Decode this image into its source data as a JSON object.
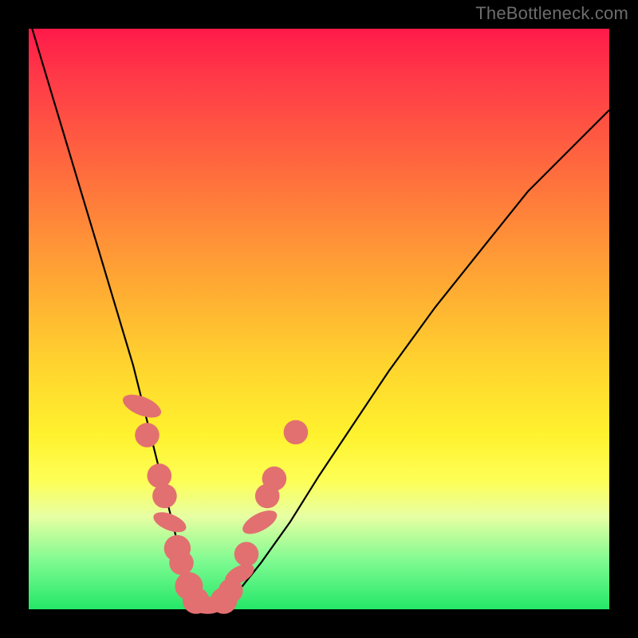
{
  "watermark": "TheBottleneck.com",
  "colors": {
    "page_bg": "#000000",
    "gradient_top": "#ff1a49",
    "gradient_bottom": "#24e768",
    "curve": "#000000",
    "marker": "#e27070"
  },
  "chart_data": {
    "type": "line",
    "title": "",
    "xlabel": "",
    "ylabel": "",
    "xlim": [
      0,
      100
    ],
    "ylim": [
      0,
      100
    ],
    "series": [
      {
        "name": "curve",
        "x": [
          0,
          3,
          6,
          9,
          12,
          15,
          18,
          20,
          22,
          24,
          25.5,
          27,
          28.5,
          30,
          33,
          36,
          40,
          45,
          50,
          56,
          62,
          70,
          78,
          86,
          94,
          100
        ],
        "y": [
          102,
          92,
          82,
          72,
          62,
          52,
          42,
          34,
          26,
          18,
          12,
          6,
          3,
          0.6,
          0.6,
          3,
          8,
          15,
          23,
          32,
          41,
          52,
          62,
          72,
          80,
          86
        ]
      }
    ],
    "markers": {
      "left_branch": [
        {
          "shape": "lozenge",
          "x": 19.5,
          "y": 35,
          "w": 3.2,
          "h": 7
        },
        {
          "shape": "round",
          "x": 20.4,
          "y": 30,
          "r": 2.1
        },
        {
          "shape": "round",
          "x": 22.5,
          "y": 23,
          "r": 2.1
        },
        {
          "shape": "round",
          "x": 23.4,
          "y": 19.5,
          "r": 2.1
        },
        {
          "shape": "lozenge",
          "x": 24.3,
          "y": 15,
          "w": 2.8,
          "h": 6
        },
        {
          "shape": "round",
          "x": 25.6,
          "y": 10.5,
          "r": 2.3
        },
        {
          "shape": "round",
          "x": 26.3,
          "y": 8.0,
          "r": 2.1
        },
        {
          "shape": "round",
          "x": 27.6,
          "y": 4.0,
          "r": 2.4
        }
      ],
      "trough": [
        {
          "shape": "round",
          "x": 28.8,
          "y": 1.5,
          "r": 2.3
        },
        {
          "shape": "lozenge",
          "x": 30.8,
          "y": 0.7,
          "w": 5.5,
          "h": 3.0
        },
        {
          "shape": "round",
          "x": 33.6,
          "y": 1.5,
          "r": 2.3
        }
      ],
      "right_branch": [
        {
          "shape": "round",
          "x": 34.8,
          "y": 3.2,
          "r": 2.1
        },
        {
          "shape": "lozenge",
          "x": 36.3,
          "y": 6.0,
          "w": 2.8,
          "h": 5.5
        },
        {
          "shape": "round",
          "x": 37.5,
          "y": 9.5,
          "r": 2.1
        },
        {
          "shape": "lozenge",
          "x": 39.8,
          "y": 15,
          "w": 3.0,
          "h": 6.5
        },
        {
          "shape": "round",
          "x": 41.1,
          "y": 19.5,
          "r": 2.1
        },
        {
          "shape": "round",
          "x": 42.3,
          "y": 22.5,
          "r": 2.1
        },
        {
          "shape": "round",
          "x": 46.0,
          "y": 30.5,
          "r": 2.1
        }
      ]
    }
  }
}
